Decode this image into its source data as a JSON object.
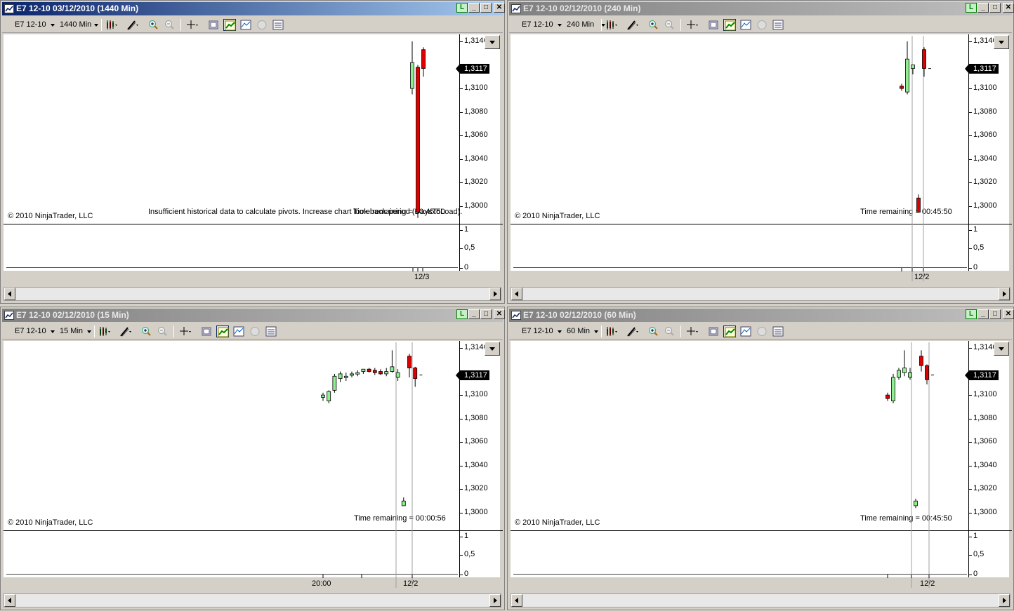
{
  "windows": [
    {
      "id": "w0",
      "title": "E7 12-10  03/12/2010 (1440 Min)",
      "active": true,
      "instrument": "E7 12-10",
      "interval": "1440 Min",
      "price_axis": [
        "1,3140",
        "1,3100",
        "1,3080",
        "1,3060",
        "1,3040",
        "1,3020",
        "1,3000"
      ],
      "current_price": "1,3117",
      "copyright": "© 2010 NinjaTrader, LLC",
      "info_text": "Insufficient historical data to calculate pivots. Increase chart look back period (DaysToLoad).",
      "overlay_text": "Time remaining = 00:45:50",
      "indicator_axis": [
        "1",
        "0,5",
        "0"
      ],
      "x_labels": [
        "12/3"
      ]
    },
    {
      "id": "w1",
      "title": "E7 12-10  02/12/2010 (240 Min)",
      "active": false,
      "instrument": "E7 12-10",
      "interval": "240 Min",
      "price_axis": [
        "1,3140",
        "1,3100",
        "1,3080",
        "1,3060",
        "1,3040",
        "1,3020",
        "1,3000"
      ],
      "current_price": "1,3117",
      "copyright": "© 2010 NinjaTrader, LLC",
      "info_text": "Time remaining = 00:45:50",
      "indicator_axis": [
        "1",
        "0,5",
        "0"
      ],
      "x_labels": [
        "12/2"
      ]
    },
    {
      "id": "w2",
      "title": "E7 12-10  02/12/2010 (15 Min)",
      "active": false,
      "instrument": "E7 12-10",
      "interval": "15 Min",
      "price_axis": [
        "1,3140",
        "1,3100",
        "1,3080",
        "1,3060",
        "1,3040",
        "1,3020",
        "1,3000"
      ],
      "current_price": "1,3117",
      "copyright": "© 2010 NinjaTrader, LLC",
      "info_text": "Time remaining = 00:00:56",
      "indicator_axis": [
        "1",
        "0,5",
        "0"
      ],
      "x_labels": [
        "20:00",
        "12/2"
      ]
    },
    {
      "id": "w3",
      "title": "E7 12-10  02/12/2010 (60 Min)",
      "active": false,
      "instrument": "E7 12-10",
      "interval": "60 Min",
      "price_axis": [
        "1,3140",
        "1,3100",
        "1,3080",
        "1,3060",
        "1,3040",
        "1,3020",
        "1,3000"
      ],
      "current_price": "1,3117",
      "copyright": "© 2010 NinjaTrader, LLC",
      "info_text": "Time remaining = 00:45:50",
      "indicator_axis": [
        "1",
        "0,5",
        "0"
      ],
      "x_labels": [
        "12/2"
      ]
    }
  ],
  "window_buttons": {
    "lock": "L",
    "minimize": "_",
    "maximize": "□",
    "close": "✕"
  },
  "toolbar_icons": [
    "bar-type-icon",
    "drawing-tool-icon",
    "zoom-in-icon",
    "zoom-out-icon",
    "crosshair-icon",
    "properties-icon",
    "data-box-icon",
    "indicators-icon",
    "strategies-icon",
    "chart-trader-icon"
  ],
  "colors": {
    "up_candle": "#90ee90",
    "down_candle": "#dd0000",
    "active_title": "#0a246a",
    "inactive_title": "#808080"
  },
  "chart_data": [
    {
      "type": "candlestick",
      "window": "1440 Min",
      "ylim": [
        1.299,
        1.3145
      ],
      "candles": [
        {
          "o": 1.31,
          "h": 1.314,
          "l": 1.3095,
          "c": 1.3122,
          "dir": "up"
        },
        {
          "o": 1.3118,
          "h": 1.312,
          "l": 1.299,
          "c": 1.2995,
          "dir": "down"
        },
        {
          "o": 1.3133,
          "h": 1.3135,
          "l": 1.311,
          "c": 1.3117,
          "dir": "down"
        }
      ]
    },
    {
      "type": "candlestick",
      "window": "240 Min",
      "ylim": [
        1.299,
        1.3145
      ],
      "candles": [
        {
          "o": 1.3102,
          "h": 1.3104,
          "l": 1.3098,
          "c": 1.31,
          "dir": "down"
        },
        {
          "o": 1.3097,
          "h": 1.314,
          "l": 1.3095,
          "c": 1.3125,
          "dir": "up"
        },
        {
          "o": 1.3117,
          "h": 1.312,
          "l": 1.3112,
          "c": 1.312,
          "dir": "up"
        },
        {
          "o": 1.3007,
          "h": 1.301,
          "l": 1.2995,
          "c": 1.2995,
          "dir": "down"
        },
        {
          "o": 1.3133,
          "h": 1.3135,
          "l": 1.311,
          "c": 1.3117,
          "dir": "down"
        },
        {
          "o": 1.3117,
          "h": 1.3117,
          "l": 1.3117,
          "c": 1.3117,
          "dir": "flat"
        }
      ]
    },
    {
      "type": "candlestick",
      "window": "15 Min",
      "ylim": [
        1.299,
        1.3145
      ],
      "candles": [
        {
          "o": 1.3098,
          "h": 1.3102,
          "l": 1.3095,
          "c": 1.31,
          "dir": "up"
        },
        {
          "o": 1.3095,
          "h": 1.3104,
          "l": 1.3093,
          "c": 1.3103,
          "dir": "up"
        },
        {
          "o": 1.3104,
          "h": 1.3118,
          "l": 1.3102,
          "c": 1.3116,
          "dir": "up"
        },
        {
          "o": 1.3114,
          "h": 1.312,
          "l": 1.3111,
          "c": 1.3118,
          "dir": "up"
        },
        {
          "o": 1.3116,
          "h": 1.3119,
          "l": 1.3112,
          "c": 1.3116,
          "dir": "up"
        },
        {
          "o": 1.3117,
          "h": 1.312,
          "l": 1.3115,
          "c": 1.3118,
          "dir": "up"
        },
        {
          "o": 1.3118,
          "h": 1.3121,
          "l": 1.3116,
          "c": 1.3119,
          "dir": "up"
        },
        {
          "o": 1.312,
          "h": 1.3122,
          "l": 1.3118,
          "c": 1.3122,
          "dir": "up"
        },
        {
          "o": 1.3122,
          "h": 1.3123,
          "l": 1.3119,
          "c": 1.312,
          "dir": "down"
        },
        {
          "o": 1.3121,
          "h": 1.3123,
          "l": 1.3117,
          "c": 1.3119,
          "dir": "down"
        },
        {
          "o": 1.312,
          "h": 1.3122,
          "l": 1.3117,
          "c": 1.3118,
          "dir": "down"
        },
        {
          "o": 1.3118,
          "h": 1.3123,
          "l": 1.3116,
          "c": 1.312,
          "dir": "up"
        },
        {
          "o": 1.312,
          "h": 1.3138,
          "l": 1.3119,
          "c": 1.3124,
          "dir": "up"
        },
        {
          "o": 1.3115,
          "h": 1.3122,
          "l": 1.3112,
          "c": 1.3119,
          "dir": "up"
        },
        {
          "o": 1.3006,
          "h": 1.3013,
          "l": 1.3006,
          "c": 1.301,
          "dir": "up"
        },
        {
          "o": 1.3133,
          "h": 1.3135,
          "l": 1.3115,
          "c": 1.3123,
          "dir": "down"
        },
        {
          "o": 1.3123,
          "h": 1.3124,
          "l": 1.3107,
          "c": 1.3114,
          "dir": "down"
        },
        {
          "o": 1.3117,
          "h": 1.3117,
          "l": 1.3117,
          "c": 1.3117,
          "dir": "flat"
        }
      ]
    },
    {
      "type": "candlestick",
      "window": "60 Min",
      "ylim": [
        1.299,
        1.3145
      ],
      "candles": [
        {
          "o": 1.31,
          "h": 1.3102,
          "l": 1.3095,
          "c": 1.3097,
          "dir": "down"
        },
        {
          "o": 1.3095,
          "h": 1.3118,
          "l": 1.3093,
          "c": 1.3115,
          "dir": "up"
        },
        {
          "o": 1.3115,
          "h": 1.3123,
          "l": 1.3113,
          "c": 1.3121,
          "dir": "up"
        },
        {
          "o": 1.3119,
          "h": 1.3138,
          "l": 1.3116,
          "c": 1.3123,
          "dir": "up"
        },
        {
          "o": 1.3115,
          "h": 1.3123,
          "l": 1.3113,
          "c": 1.3119,
          "dir": "up"
        },
        {
          "o": 1.3006,
          "h": 1.3012,
          "l": 1.3004,
          "c": 1.301,
          "dir": "up"
        },
        {
          "o": 1.3133,
          "h": 1.3138,
          "l": 1.312,
          "c": 1.3125,
          "dir": "down"
        },
        {
          "o": 1.3125,
          "h": 1.3126,
          "l": 1.3109,
          "c": 1.3113,
          "dir": "down"
        },
        {
          "o": 1.3117,
          "h": 1.3117,
          "l": 1.3117,
          "c": 1.3117,
          "dir": "flat"
        }
      ]
    }
  ]
}
